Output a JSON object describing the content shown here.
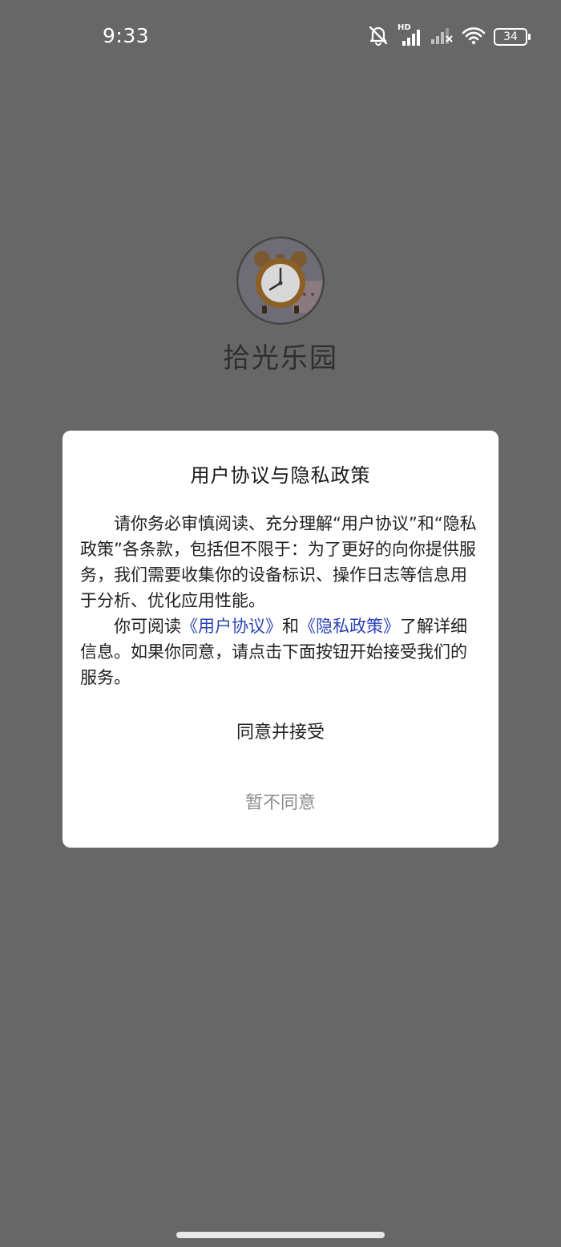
{
  "status_bar": {
    "time": "9:33",
    "network_label": "HD",
    "battery_level": "34",
    "icons": [
      "mute-icon",
      "cellular-signal-icon",
      "cellular-signal-weak-icon",
      "wifi-icon",
      "battery-icon"
    ]
  },
  "app": {
    "name": "拾光乐园",
    "logo": "alarm-clock-logo"
  },
  "dialog": {
    "title": "用户协议与隐私政策",
    "paragraph1": "请你务必审慎阅读、充分理解“用户协议”和“隐私政策”各条款，包括但不限于：为了更好的向你提供服务，我们需要收集你的设备标识、操作日志等信息用于分析、优化应用性能。",
    "paragraph2_prefix": "你可阅读",
    "user_agreement_link": "《用户协议》",
    "paragraph2_and": "和",
    "privacy_policy_link": "《隐私政策》",
    "paragraph2_suffix": "了解详细信息。如果你同意，请点击下面按钮开始接受我们的服务。",
    "agree_button": "同意并接受",
    "disagree_button": "暂不同意"
  },
  "colors": {
    "overlay_background": "#676767",
    "link": "#2b43b5",
    "disagree_text": "#8e8e8e"
  }
}
